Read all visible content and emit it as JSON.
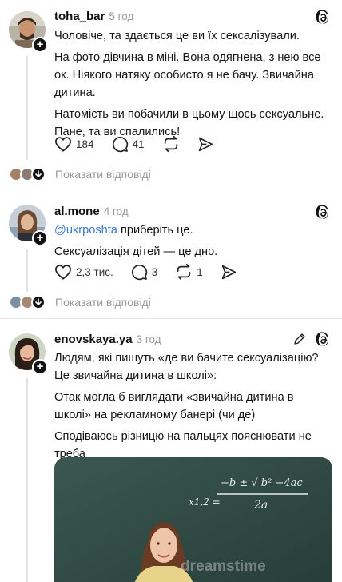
{
  "posts": [
    {
      "username": "toha_bar",
      "time": "5 год",
      "paragraphs": [
        "Чоловіче, та здається це ви їх сексалізували.",
        "На фото дівчина в міні. Вона одягнена, з нею все ок. Ніякого натяку особисто я не бачу. Звичайна дитина.",
        "Натомість ви побачили в цьому щось сексуальне. Пане, та ви спалились!"
      ],
      "likes": "184",
      "comments": "41",
      "reposts": "",
      "replies_label": "Показати відповіді"
    },
    {
      "username": "al.mone",
      "time": "4 год",
      "mention": "@ukrposhta",
      "mention_rest": " приберіть це.",
      "paragraph2": "Сексуалізація дітей — це дно.",
      "likes": "2,3 тис.",
      "comments": "3",
      "reposts": "1",
      "replies_label": "Показати відповіді"
    },
    {
      "username": "enovskaya.ya",
      "time": "3 год",
      "paragraphs": [
        "Людям, які пишуть «де ви бачите сексуалізацію? Це звичайна дитина в школі»:",
        "Отак могла б виглядати «звичайна дитина в школі» на рекламному банері (чи де)",
        "Сподіваюсь різницю на пальцях пояснювати не треба"
      ],
      "image": {
        "formula": "x1,2 = (−b ± √(b² − 4ac)) / 2a",
        "formula_top": "−b ± √ b² −4ac",
        "formula_bottom": "2a",
        "formula_left": "x1,2 =",
        "watermark": "dreamstime"
      }
    }
  ],
  "colors": {
    "mention": "#3b78c5",
    "muted": "#999999",
    "board": "#2f4a42"
  },
  "icons": [
    "threads-icon",
    "heart-icon",
    "comment-icon",
    "repost-icon",
    "share-icon",
    "pencil-icon",
    "plus-icon",
    "chevron-down-icon"
  ]
}
